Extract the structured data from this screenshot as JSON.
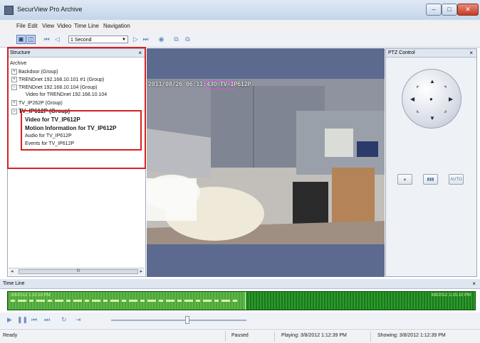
{
  "window": {
    "title": "SecurView Pro Archive",
    "buttons": [
      "–",
      "□",
      "✕"
    ]
  },
  "menu": [
    "File",
    "Edit",
    "View",
    "Video",
    "Time Line",
    "Navigation"
  ],
  "toolbar": {
    "interval_value": "1 Second"
  },
  "structure": {
    "title": "Structure",
    "close": "×",
    "root": "Archive",
    "items": [
      {
        "toggle": "+",
        "label": "Backdoor (Group)"
      },
      {
        "toggle": "+",
        "label": "TRENDnet 192.168.10.101 #1 (Group)"
      },
      {
        "toggle": "−",
        "label": "TRENDnet 192.168.10.104 (Group)"
      },
      {
        "toggle": "",
        "label": "Video for TRENDnet 192.168.10.104"
      },
      {
        "toggle": "+",
        "label": "TV_IP262P (Group)"
      },
      {
        "toggle": "−",
        "label": "TV_IP612P (Group)"
      },
      {
        "toggle": "",
        "label": "Video for TV_IP612P"
      },
      {
        "toggle": "",
        "label": "Motion Information for TV_IP612P"
      },
      {
        "toggle": "",
        "label": "Audio for TV_IP612P"
      },
      {
        "toggle": "",
        "label": "Events for TV_IP612P"
      }
    ],
    "scroll_label": "III"
  },
  "video": {
    "overlay_text": "2011/08/26 06:11:43O TV-IP612P"
  },
  "ptz": {
    "title": "PTZ Control",
    "close": "×",
    "buttons": [
      "▲",
      "▼",
      "◀",
      "▶",
      "●"
    ],
    "diagonals": [
      "◤",
      "◥",
      "◣",
      "◢"
    ],
    "mode_buttons": [
      "▲",
      "▮▮▮",
      "AUTO"
    ]
  },
  "timeline": {
    "title": "Time Line",
    "close": "×",
    "start_label": "3/8/2012 1:10:10 PM",
    "end_label": "3/8/2012 1:15:10 PM"
  },
  "status": {
    "state": "Ready",
    "play_state": "Paused",
    "playing": "Playing: 3/8/2012 1:12:39 PM",
    "showing": "Showing: 3/8/2012 1:12:39 PM"
  }
}
